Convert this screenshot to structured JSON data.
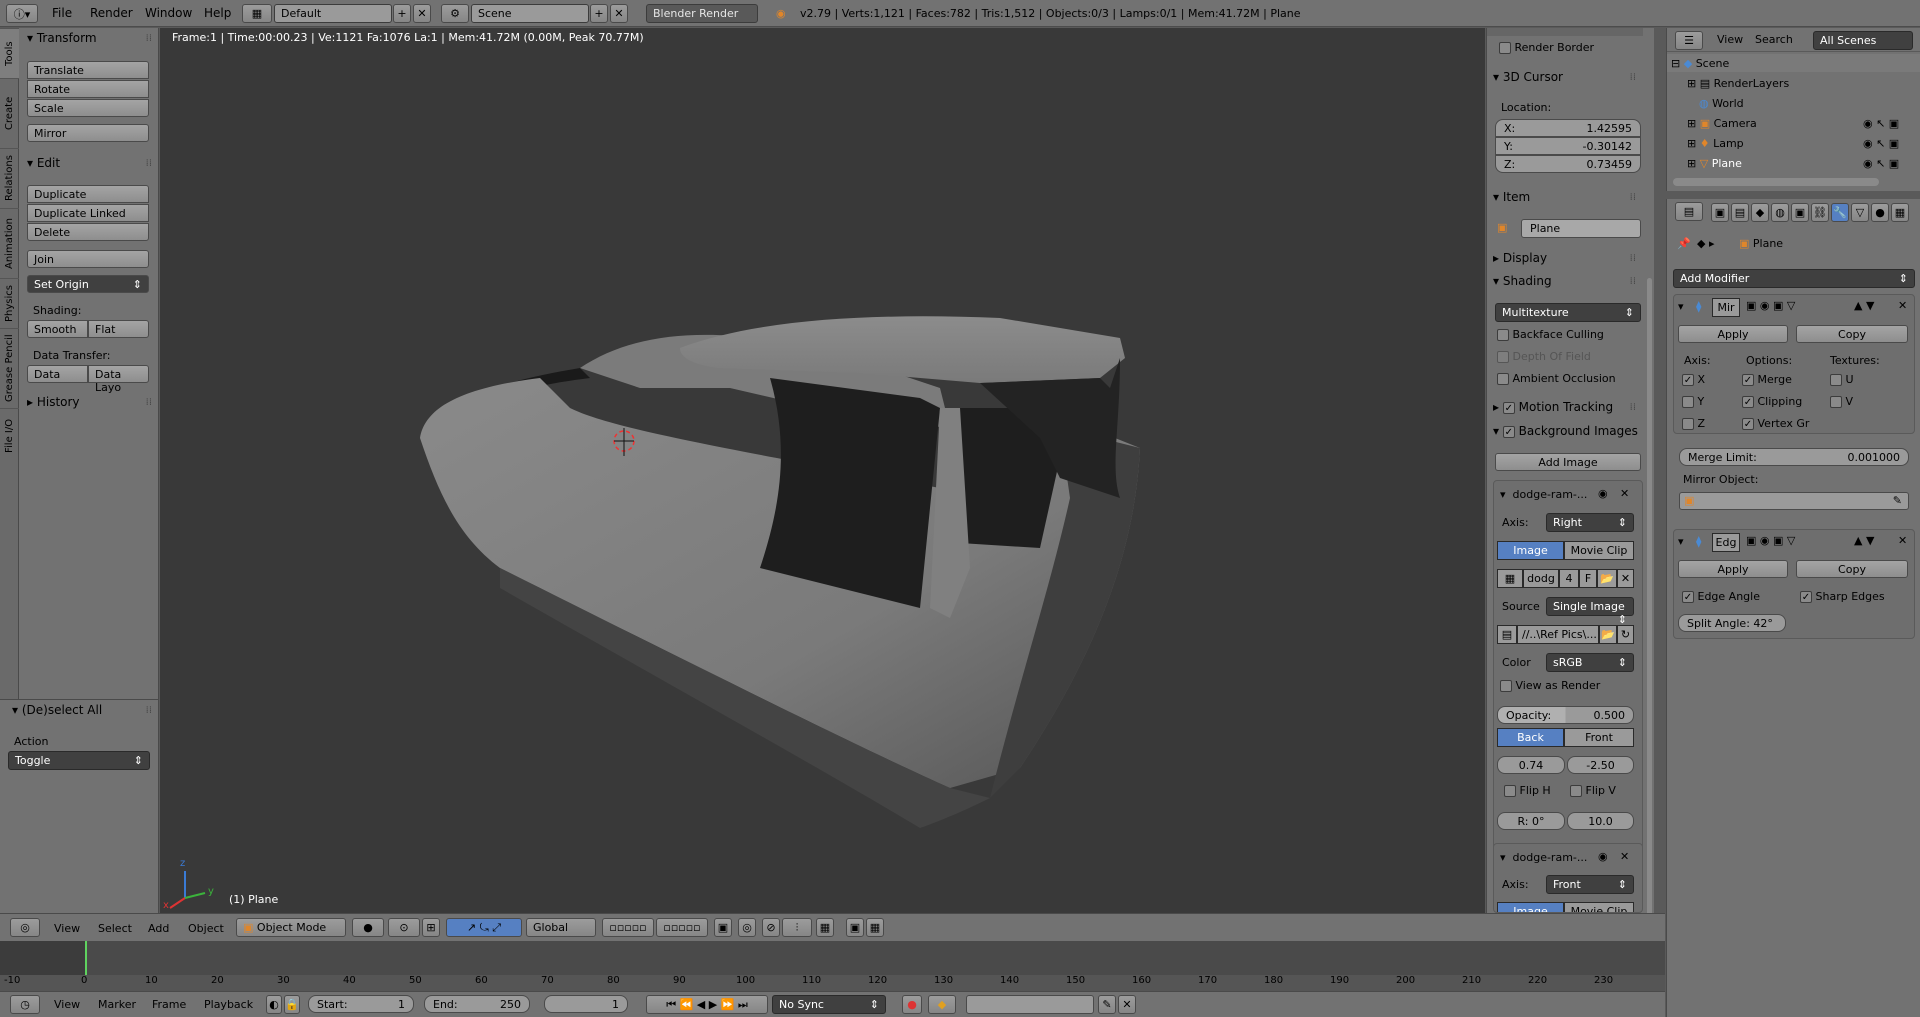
{
  "topbar": {
    "menus": [
      "File",
      "Render",
      "Window",
      "Help"
    ],
    "layout": "Default",
    "scene": "Scene",
    "engine": "Blender Render",
    "stats": "v2.79 | Verts:1,121 | Faces:782 | Tris:1,512 | Objects:0/3 | Lamps:0/1 | Mem:41.72M | Plane"
  },
  "tabs": [
    "Tools",
    "Create",
    "Relations",
    "Animation",
    "Physics",
    "Grease Pencil",
    "File I/O"
  ],
  "toolshelf": {
    "transform_title": "Transform",
    "transform_buttons": [
      "Translate",
      "Rotate",
      "Scale"
    ],
    "mirror": "Mirror",
    "edit_title": "Edit",
    "edit_buttons": [
      "Duplicate",
      "Duplicate Linked",
      "Delete"
    ],
    "join": "Join",
    "set_origin": "Set Origin",
    "shading_label": "Shading:",
    "smooth": "Smooth",
    "flat": "Flat",
    "data_transfer_label": "Data Transfer:",
    "data": "Data",
    "data_layout": "Data Layo",
    "history_title": "History",
    "deselect_title": "(De)select All",
    "action_label": "Action",
    "action_value": "Toggle"
  },
  "viewport": {
    "info": "Frame:1 | Time:00:00.23 | Ve:1121 Fa:1076 La:1 | Mem:41.72M (0.00M, Peak 70.77M)",
    "object_name": "(1) Plane",
    "axis_x": "x",
    "axis_y": "y",
    "axis_z": "z"
  },
  "npanel": {
    "render_border": "Render Border",
    "cursor_title": "3D Cursor",
    "location_label": "Location:",
    "x_label": "X:",
    "x_value": "1.42595",
    "y_label": "Y:",
    "y_value": "-0.30142",
    "z_label": "Z:",
    "z_value": "0.73459",
    "item_title": "Item",
    "item_name": "Plane",
    "display_title": "Display",
    "shading_title": "Shading",
    "shading_mode": "Multitexture",
    "backface": "Backface Culling",
    "depth_of_field": "Depth Of Field",
    "ambient_occlusion": "Ambient Occlusion",
    "motion_tracking": "Motion Tracking",
    "background_images": "Background Images",
    "add_image": "Add Image",
    "bg1_name": "dodge-ram-...",
    "axis_label": "Axis:",
    "bg1_axis": "Right",
    "image_tab": "Image",
    "movie_clip_tab": "Movie Clip",
    "img_name": "dodg",
    "img_users": "4",
    "img_fake": "F",
    "source_label": "Source",
    "source_value": "Single Image",
    "path_value": "//..\\Ref Pics\\...",
    "color_label": "Color",
    "color_value": "sRGB",
    "view_as_render": "View as Render",
    "opacity_label": "Opacity:",
    "opacity_value": "0.500",
    "back": "Back",
    "front": "Front",
    "offset_x": "0.74",
    "offset_y": "-2.50",
    "flip_h": "Flip H",
    "flip_v": "Flip V",
    "rotation": "R: 0°",
    "size": "10.0",
    "bg2_name": "dodge-ram-...",
    "bg2_axis": "Front"
  },
  "outliner": {
    "view": "View",
    "search": "Search",
    "filter": "All Scenes",
    "items": [
      "Scene",
      "RenderLayers",
      "World",
      "Camera",
      "Lamp",
      "Plane"
    ]
  },
  "props": {
    "breadcrumb": "Plane",
    "add_modifier": "Add Modifier",
    "mirror_name": "Mir",
    "apply": "Apply",
    "copy": "Copy",
    "axis_label": "Axis:",
    "options_label": "Options:",
    "textures_label": "Textures:",
    "ax_x": "X",
    "ax_y": "Y",
    "ax_z": "Z",
    "merge": "Merge",
    "clipping": "Clipping",
    "vertex_gr": "Vertex Gr",
    "tex_u": "U",
    "tex_v": "V",
    "merge_limit_label": "Merge Limit:",
    "merge_limit_value": "0.001000",
    "mirror_object_label": "Mirror Object:",
    "edge_name": "Edg",
    "edge_angle": "Edge Angle",
    "sharp_edges": "Sharp Edges",
    "split_angle": "Split Angle: 42°"
  },
  "vp_header": {
    "view": "View",
    "select": "Select",
    "add": "Add",
    "object": "Object",
    "mode": "Object Mode",
    "orientation": "Global"
  },
  "timeline": {
    "ticks": [
      "-10",
      "0",
      "10",
      "20",
      "30",
      "40",
      "50",
      "60",
      "70",
      "80",
      "90",
      "100",
      "110",
      "120",
      "130",
      "140",
      "150",
      "160",
      "170",
      "180",
      "190",
      "200",
      "210",
      "220",
      "230"
    ],
    "view": "View",
    "marker": "Marker",
    "frame": "Frame",
    "playback": "Playback",
    "start_label": "Start:",
    "start_value": "1",
    "end_label": "End:",
    "end_value": "250",
    "current": "1",
    "sync": "No Sync"
  },
  "colors": {
    "accent_blue": "#5680c2",
    "viewport_bg": "#393939",
    "panel_bg": "#727272"
  }
}
